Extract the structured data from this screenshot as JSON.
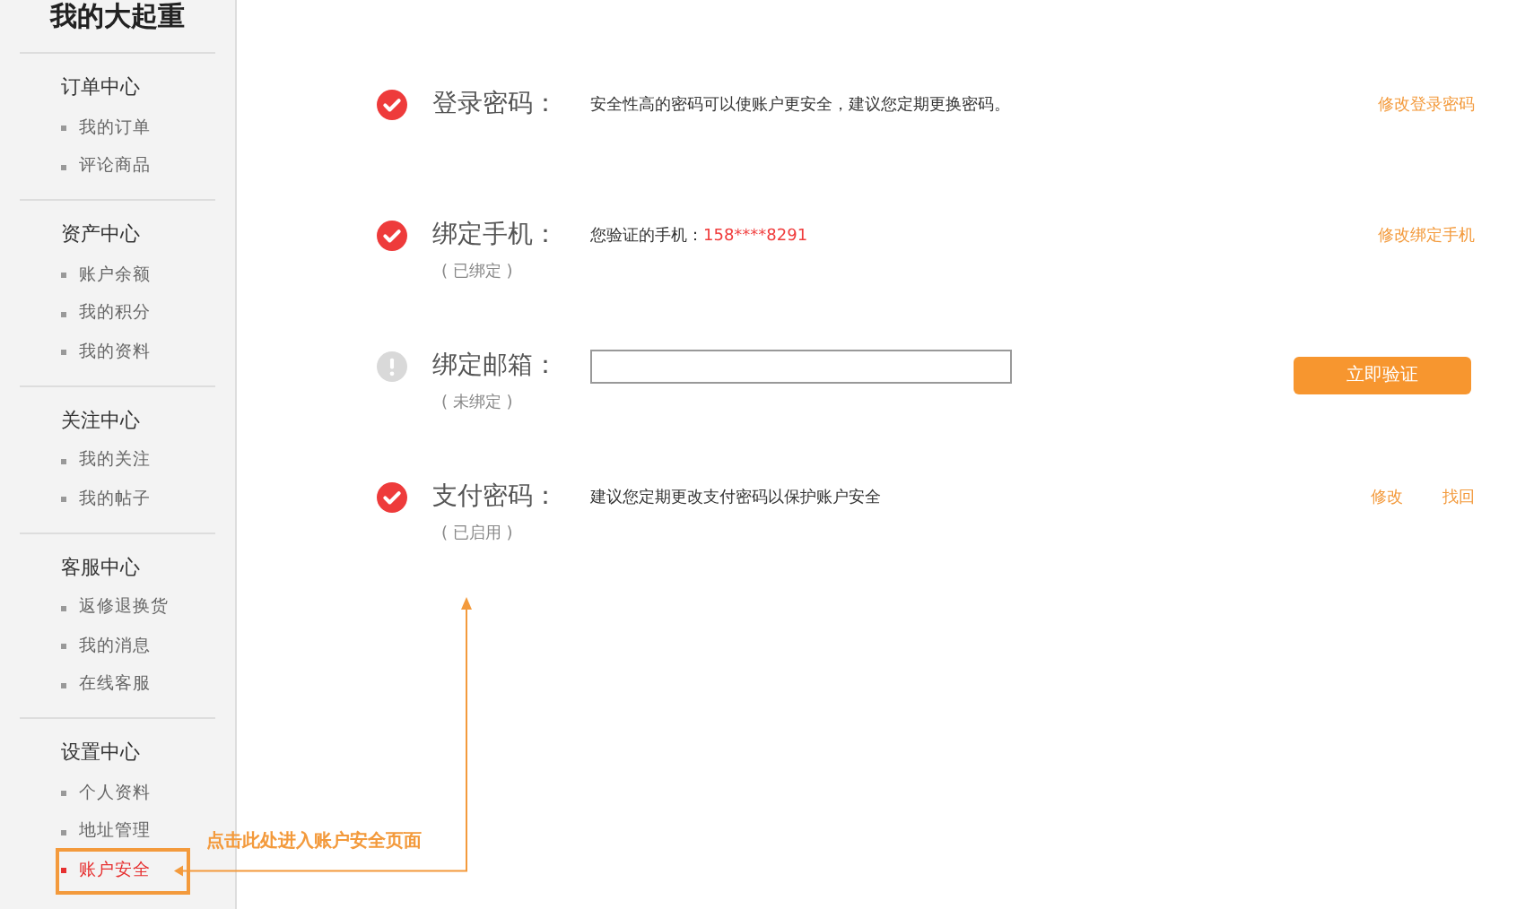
{
  "sidebar": {
    "title": "我的大起重",
    "sections": [
      {
        "heading": "订单中心",
        "items": [
          {
            "label": "我的订单",
            "selected": false
          },
          {
            "label": "评论商品",
            "selected": false
          }
        ]
      },
      {
        "heading": "资产中心",
        "items": [
          {
            "label": "账户余额",
            "selected": false
          },
          {
            "label": "我的积分",
            "selected": false
          },
          {
            "label": "我的资料",
            "selected": false
          }
        ]
      },
      {
        "heading": "关注中心",
        "items": [
          {
            "label": "我的关注",
            "selected": false
          },
          {
            "label": "我的帖子",
            "selected": false
          }
        ]
      },
      {
        "heading": "客服中心",
        "items": [
          {
            "label": "返修退换货",
            "selected": false
          },
          {
            "label": "我的消息",
            "selected": false
          },
          {
            "label": "在线客服",
            "selected": false
          }
        ]
      },
      {
        "heading": "设置中心",
        "items": [
          {
            "label": "个人资料",
            "selected": false
          },
          {
            "label": "地址管理",
            "selected": false
          },
          {
            "label": "账户安全",
            "selected": true
          }
        ]
      }
    ]
  },
  "security_items": [
    {
      "label": "登录密码：",
      "verified": true,
      "description": "安全性高的密码可以使账户更安全，建议您定期更换密码。",
      "actions": [
        {
          "kind": "link",
          "label": "修改登录密码"
        }
      ]
    },
    {
      "label": "绑定手机：",
      "verified": true,
      "status": "( 已绑定 )",
      "description": "您验证的手机：",
      "value": "158****8291",
      "actions": [
        {
          "kind": "link",
          "label": "修改绑定手机"
        }
      ]
    },
    {
      "label": "绑定邮箱：",
      "verified": false,
      "status": "( 未绑定 )",
      "input": true,
      "actions": [
        {
          "kind": "button",
          "label": "立即验证"
        }
      ]
    },
    {
      "label": "支付密码：",
      "verified": true,
      "status": "( 已启用 )",
      "description": "建议您定期更改支付密码以保护账户安全",
      "actions": [
        {
          "kind": "link",
          "label": "修改"
        },
        {
          "kind": "link",
          "label": "找回"
        }
      ]
    }
  ],
  "annotation": {
    "text": "点击此处进入账户安全页面"
  }
}
